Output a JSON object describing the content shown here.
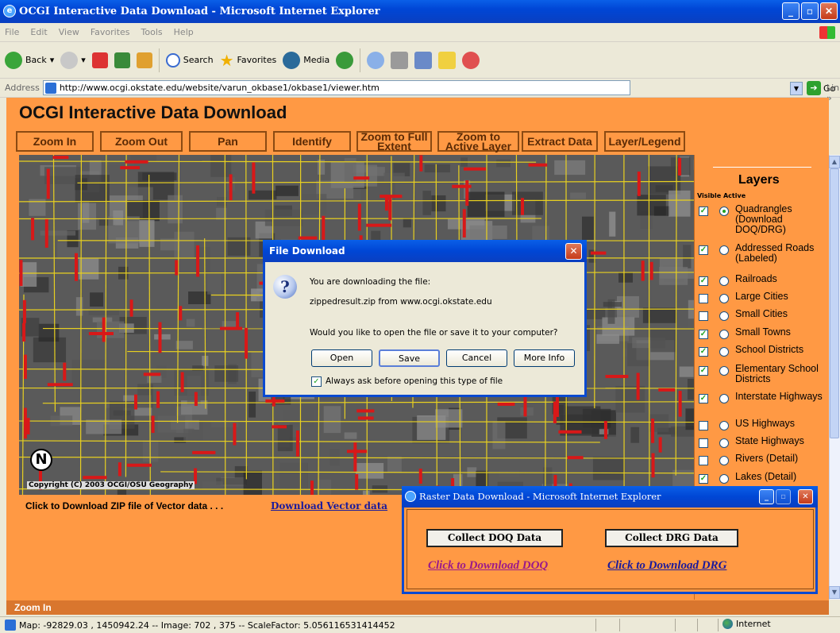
{
  "window": {
    "title": "OCGI Interactive Data Download - Microsoft Internet Explorer"
  },
  "menu": [
    "File",
    "Edit",
    "View",
    "Favorites",
    "Tools",
    "Help"
  ],
  "toolbar": {
    "back": "Back",
    "search": "Search",
    "favorites": "Favorites",
    "media": "Media"
  },
  "address": {
    "label": "Address",
    "url": "http://www.ocgi.okstate.edu/website/varun_okbase1/okbase1/viewer.htm",
    "go": "Go",
    "links": "Links"
  },
  "app": {
    "title": "OCGI Interactive Data Download",
    "tools": [
      "Zoom In",
      "Zoom Out",
      "Pan",
      "Identify",
      "Zoom to Full Extent",
      "Zoom to Active Layer",
      "Extract Data",
      "Layer/Legend"
    ]
  },
  "map": {
    "copyright": "Copyright (C) 2003 OCGI/OSU Geography",
    "north": "N"
  },
  "layers": {
    "title": "Layers",
    "header": "Visible Active",
    "items": [
      {
        "name": "Quadrangles (Download DOQ/DRG)",
        "visible": true,
        "active": true
      },
      {
        "name": "Addressed Roads (Labeled)",
        "visible": true,
        "active": false
      },
      {
        "name": "Railroads",
        "visible": true,
        "active": false
      },
      {
        "name": "Large Cities",
        "visible": false,
        "active": false
      },
      {
        "name": "Small Cities",
        "visible": false,
        "active": false
      },
      {
        "name": "Small Towns",
        "visible": true,
        "active": false
      },
      {
        "name": "School Districts",
        "visible": true,
        "active": false
      },
      {
        "name": "Elementary School Districts",
        "visible": true,
        "active": false
      },
      {
        "name": "Interstate Highways",
        "visible": true,
        "active": false
      },
      {
        "name": "US Highways",
        "visible": false,
        "active": false
      },
      {
        "name": "State Highways",
        "visible": false,
        "active": false
      },
      {
        "name": "Rivers (Detail)",
        "visible": false,
        "active": false
      },
      {
        "name": "Lakes (Detail)",
        "visible": true,
        "active": false
      }
    ]
  },
  "bottom": {
    "zip_message": "Click to Download ZIP file of Vector data . . .",
    "download_vector": "Download Vector data",
    "mode": "Zoom In"
  },
  "status": {
    "text": "Map: -92829.03 , 1450942.24 -- Image: 702 , 375 -- ScaleFactor: 5.056116531414452",
    "zone": "Internet"
  },
  "file_download": {
    "title": "File Download",
    "line1": "You are downloading the file:",
    "line2": "zippedresult.zip from www.ocgi.okstate.edu",
    "question": "Would you like to open the file or save it to your computer?",
    "buttons": [
      "Open",
      "Save",
      "Cancel",
      "More Info"
    ],
    "checkbox_label": "Always ask before opening this type of file",
    "checkbox_checked": true
  },
  "raster_popup": {
    "title": "Raster Data Download - Microsoft Internet Explorer",
    "collect_doq": "Collect DOQ Data",
    "collect_drg": "Collect DRG Data",
    "download_doq": "Click to Download DOQ",
    "download_drg": "Click to Download DRG"
  },
  "colors": {
    "page": "#ff9944",
    "xp_blue": "#0046d5",
    "road": "#e8d020",
    "label_red": "#d81818"
  }
}
